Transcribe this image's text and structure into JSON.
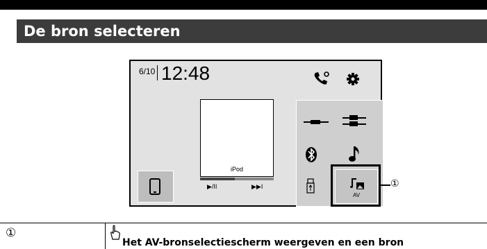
{
  "heading": "De bron selecteren",
  "screen": {
    "date": "6/10",
    "time": "12:48",
    "source_label": "iPod",
    "progress": 0.47,
    "play_pause": "▶/II",
    "next": "▶▶I",
    "av_label": "AV"
  },
  "callout": "①",
  "table": {
    "number": "①",
    "text": "Het AV-bronselectiescherm weergeven en een bron"
  },
  "icons": [
    "phone-call-icon",
    "gear-icon",
    "mobile-phone-icon",
    "aux-cable-icon",
    "rca-cable-icon",
    "bluetooth-icon",
    "music-note-icon",
    "usb-icon",
    "av-source-icon",
    "tap-hand-icon"
  ]
}
